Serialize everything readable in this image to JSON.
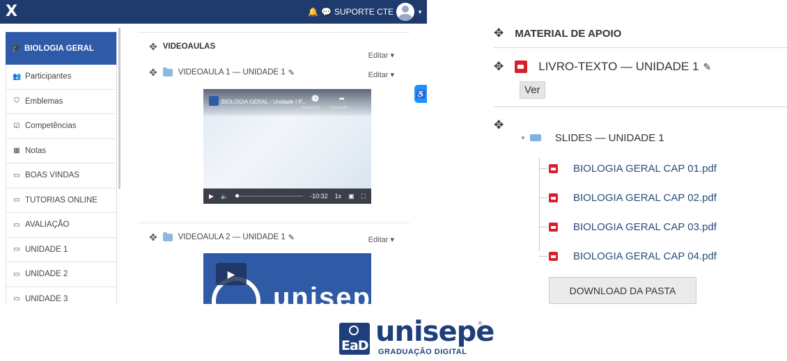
{
  "topbar": {
    "close_label": "X",
    "user_name": "SUPORTE CTE",
    "bg_color": "#1f3b6e"
  },
  "sidebar": {
    "items": [
      {
        "label": "BIOLOGIA GERAL",
        "icon": "graduation-cap-icon",
        "glyph": "🎓",
        "active": true
      },
      {
        "label": "Participantes",
        "icon": "users-icon",
        "glyph": "👥"
      },
      {
        "label": "Emblemas",
        "icon": "shield-icon",
        "glyph": "⛉"
      },
      {
        "label": "Competências",
        "icon": "checkbox-icon",
        "glyph": "☑"
      },
      {
        "label": "Notas",
        "icon": "table-icon",
        "glyph": "▦"
      },
      {
        "label": "BOAS VINDAS",
        "icon": "folder-icon",
        "glyph": "▭"
      },
      {
        "label": "TUTORIAS ONLINE",
        "icon": "folder-icon",
        "glyph": "▭"
      },
      {
        "label": "AVALIAÇÃO",
        "icon": "folder-icon",
        "glyph": "▭"
      },
      {
        "label": "UNIDADE 1",
        "icon": "folder-icon",
        "glyph": "▭"
      },
      {
        "label": "UNIDADE 2",
        "icon": "folder-icon",
        "glyph": "▭"
      },
      {
        "label": "UNIDADE 3",
        "icon": "folder-icon",
        "glyph": "▭"
      }
    ],
    "active_color": "#2e5aa8"
  },
  "content": {
    "section_title": "VIDEOAULAS",
    "edit_label": "Editar",
    "video1": {
      "title": "VIDEOAULA 1 — UNIDADE 1",
      "player_title": "BIOLOGIA GERAL - Unidade I P...",
      "watch_later": "Assistir mai...",
      "share": "Compartilh...",
      "time": "-10:32",
      "speed": "1x"
    },
    "video2": {
      "title": "VIDEOAULA 2 — UNIDADE 1",
      "brand_text": "unisepe"
    }
  },
  "right": {
    "section_title": "MATERIAL DE APOIO",
    "livro": "LIVRO-TEXTO — UNIDADE 1",
    "ver_label": "Ver",
    "slides_folder": "SLIDES — UNIDADE 1",
    "files": [
      "BIOLOGIA GERAL CAP 01.pdf",
      "BIOLOGIA GERAL CAP 02.pdf",
      "BIOLOGIA GERAL CAP 03.pdf",
      "BIOLOGIA GERAL CAP 04.pdf"
    ],
    "download_label": "DOWNLOAD DA PASTA"
  },
  "logo": {
    "box_text": "EaD",
    "word": "unisepe",
    "reg": "®",
    "subtitle": "GRADUAÇÃO DIGITAL",
    "color": "#1f3f7a"
  }
}
